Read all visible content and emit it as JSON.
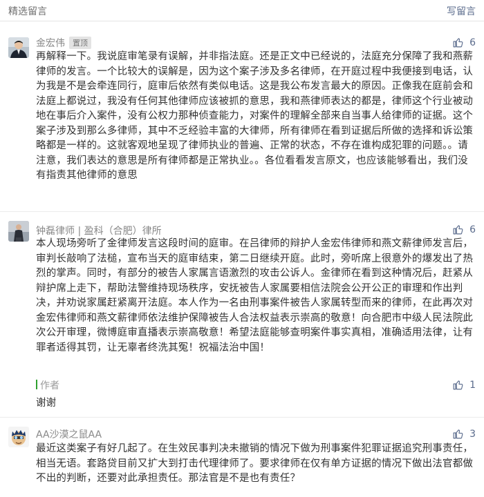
{
  "header": {
    "title": "精选留言",
    "write": "写留言"
  },
  "comments": [
    {
      "name": "金宏伟",
      "badge": "置顶",
      "likes": "6",
      "text": "再解释一下。我说庭审笔录有误解，并非指法庭。还是正文中已经说的，法庭充分保障了我和燕薪律师的发言。一个比较大的误解是，因为这个案子涉及多名律师，在开庭过程中我便接到电话，认为我是不是会牵连同行，庭审后依然有类似电话。这是我公布发言最大的原因。正像我在庭前会和法庭上都说过，我没有任何其他律师应该被抓的意思，我和燕律师表达的都是，律师这个行业被动地在事后介入案件，没有公权力那种侦查能力，对案件的理解全部来自当事人给律师的证据。这个案子涉及到那么多律师，其中不乏经验丰富的大律师，所有律师在看到证据后所做的选择和诉讼策略都是一样的。这就客观地呈现了律师执业的普遍、正常的状态，不存在谁构成犯罪的问题。。请注意，我们表达的意思是所有律师都是正常执业。。各位看看发言原文，也应该能够看出，我们没有指责其他律师的意思"
    },
    {
      "name": "钟磊律师 | 盈科（合肥）律所",
      "likes": "6",
      "text": "本人现场旁听了金律师发言这段时间的庭审。在吕律师的辩护人金宏伟律师和燕文薪律师发言后，审判长敲响了法槌，宣布当天的庭审结束，第二日继续开庭。此时，旁听席上很意外的爆发出了热烈的掌声。同时，有部分的被告人家属言语激烈的攻击公诉人。金律师在看到这种情况后，赶紧从辩护席上走下，帮助法警维持现场秩序，安抚被告人家属要相信法院会公开公正的审理和作出判决，并劝说家属赶紧离开法庭。本人作为一名由刑事案件被告人家属转型而来的律师，在此再次对金宏伟律师和燕文薪律师依法维护保障被告人合法权益表示崇高的敬意！向合肥市中级人民法院此次公开审理，微博庭审直播表示崇高敬意！希望法庭能够查明案件事实真相，准确适用法律，让有罪者适得其罚，让无辜者终洗其冤！祝福法治中国！",
      "reply": {
        "label": "作者",
        "likes": "1",
        "text": "谢谢"
      }
    },
    {
      "name": "AA沙漠之鼠AA",
      "likes": "3",
      "text": "最近这类案子有好几起了。在生效民事判决未撤销的情况下做为刑事案件犯罪证据追究刑事责任，相当无语。套路贷目前又扩大到打击代理律师了。要求律师在仅有单方证据的情况下做出法官都做不出的判断，还要对此承担责任。那法官是不是也有责任？"
    }
  ]
}
